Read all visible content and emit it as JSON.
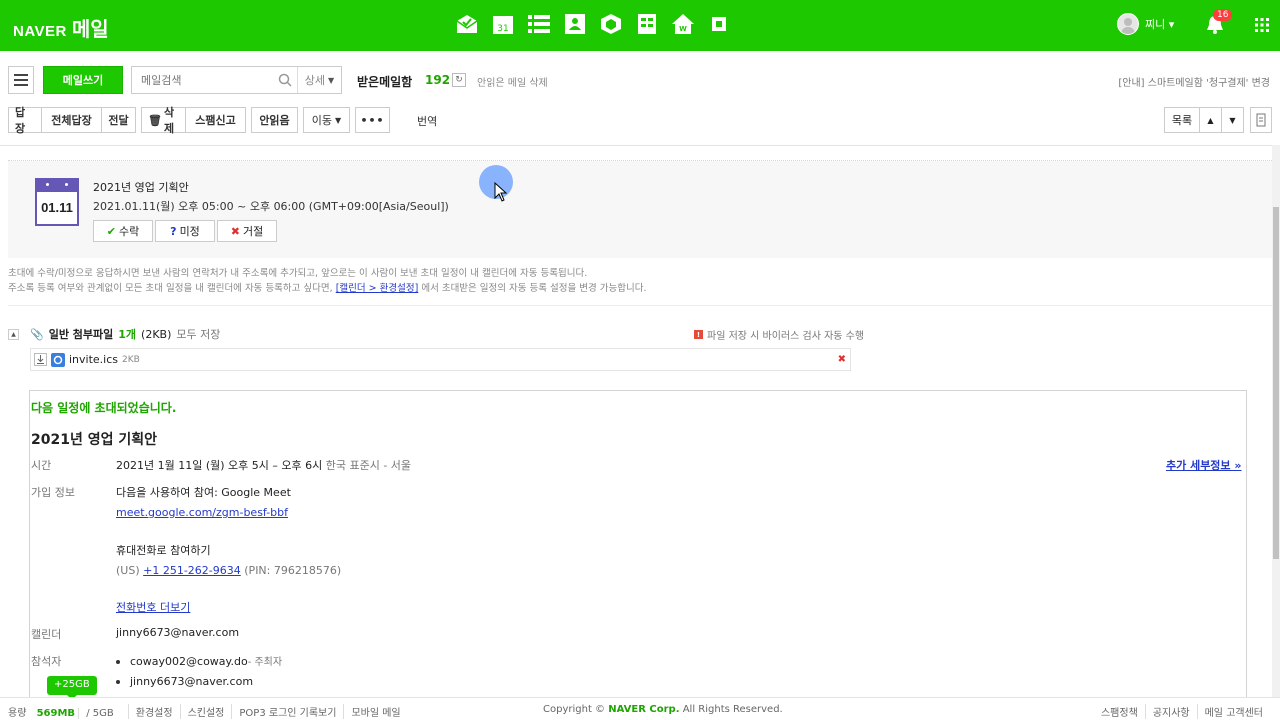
{
  "header": {
    "logo_brand": "NAVER",
    "logo_service": "메일",
    "apps": [
      "mail-icon",
      "calendar-icon",
      "list-icon",
      "contacts-icon",
      "cube-icon",
      "memo-icon",
      "home-icon",
      "square-icon"
    ],
    "calendar_icon_num": "31",
    "user_name": "찌니 ▾",
    "notification_count": "16",
    "brand_color": "#1ec800"
  },
  "mailbar": {
    "compose": "메일쓰기",
    "search_placeholder": "메일검색",
    "search_detail": "상세",
    "folder": "받은메일함",
    "count": "192",
    "delete_unread": "안읽은 메일 삭제",
    "notice": "[안내] 스마트메일함 '청구결제' 변경"
  },
  "toolbar": {
    "reply": "답장",
    "reply_all": "전체답장",
    "forward": "전달",
    "delete": "삭제",
    "spam": "스팸신고",
    "unread": "안읽음",
    "move": "이동",
    "more": "•••",
    "translate": "번역",
    "list": "목록"
  },
  "invite": {
    "date_icon": "01.11",
    "title": "2021년 영업 기획안",
    "time": "2021.01.11(월) 오후 05:00 ~ 오후 06:00 (GMT+09:00[Asia/Seoul])",
    "accept": "수락",
    "maybe": "미정",
    "decline": "거절",
    "info_line1": "초대에 수락/미정으로 응답하시면 보낸 사람의 연락처가 내 주소록에 추가되고, 앞으로는 이 사람이 보낸 초대 일정이 내 캘린더에 자동 등록됩니다.",
    "info_line2_pre": "주소록 등록 여부와 관계없이 모든 초대 일정을 내 캘린더에 자동 등록하고 싶다면,",
    "info_link": "[캘린더 > 환경설정]",
    "info_line2_post": "에서 초대받은 일정의 자동 등록 설정을 변경 가능합니다."
  },
  "attachment": {
    "label": "일반 첨부파일",
    "count": "1개",
    "size": "(2KB)",
    "save_all": "모두 저장",
    "virus_notice": "파일 저장 시 바이러스 검사 자동 수행",
    "file_name": "invite.ics",
    "file_size": "2KB"
  },
  "body": {
    "invited_text": "다음 일정에 초대되었습니다.",
    "title": "2021년 영업 기획안",
    "time_label": "시간",
    "time_value": "2021년 1월 11일 (월) 오후 5시 – 오후 6시",
    "time_zone": "한국 표준시 - 서울",
    "more_details": "추가 세부정보 »",
    "join_label": "가입 정보",
    "join_meet": "다음을 사용하여 참여: Google Meet",
    "meet_link": "meet.google.com/zgm-besf-bbf",
    "phone_join": "휴대전화로 참여하기",
    "phone_country": "(US)",
    "phone_number": "+1 251-262-9634",
    "phone_pin": "(PIN: 796218576)",
    "more_phones": "전화번호 더보기",
    "calendar_label": "캘린더",
    "calendar_value": "jinny6673@naver.com",
    "attendees_label": "참석자",
    "attendee1": "coway002@coway.do",
    "attendee1_role": "- 주최자",
    "attendee2": "jinny6673@naver.com"
  },
  "footer": {
    "quota_bubble": "+25GB",
    "usage_label": "용량",
    "usage_value": "569MB",
    "usage_total": "/ 5GB",
    "settings": "환경설정",
    "skin": "스킨설정",
    "pop3": "POP3 로그인 기록보기",
    "mobile": "모바일 메일",
    "copyright_pre": "Copyright ©",
    "copyright_corp": "NAVER Corp.",
    "copyright_post": "All Rights Reserved.",
    "spam_policy": "스팸정책",
    "notices": "공지사항",
    "help": "메일 고객센터"
  }
}
